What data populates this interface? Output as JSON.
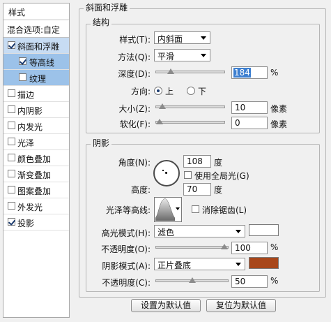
{
  "sidebar": {
    "header": "样式",
    "blend_options": "混合选项:自定",
    "items": [
      {
        "label": "斜面和浮雕",
        "checked": true
      },
      {
        "label": "等高线",
        "checked": true
      },
      {
        "label": "纹理",
        "checked": false
      },
      {
        "label": "描边",
        "checked": false
      },
      {
        "label": "内阴影",
        "checked": false
      },
      {
        "label": "内发光",
        "checked": false
      },
      {
        "label": "光泽",
        "checked": false
      },
      {
        "label": "颜色叠加",
        "checked": false
      },
      {
        "label": "渐变叠加",
        "checked": false
      },
      {
        "label": "图案叠加",
        "checked": false
      },
      {
        "label": "外发光",
        "checked": false
      },
      {
        "label": "投影",
        "checked": true
      }
    ]
  },
  "bevel": {
    "title": "斜面和浮雕",
    "structure": {
      "title": "结构",
      "style_label": "样式(T):",
      "style_value": "内斜面",
      "technique_label": "方法(Q):",
      "technique_value": "平滑",
      "depth_label": "深度(D):",
      "depth_value": "184",
      "depth_unit": "%",
      "depth_level": 0.184,
      "direction_label": "方向:",
      "direction_up": "上",
      "direction_down": "下",
      "size_label": "大小(Z):",
      "size_value": "10",
      "size_unit": "像素",
      "size_level": 0.04,
      "soften_label": "软化(F):",
      "soften_value": "0",
      "soften_unit": "像素",
      "soften_level": 0.0
    },
    "shading": {
      "title": "阴影",
      "angle_label": "角度(N):",
      "angle_value": "108",
      "angle_unit": "度",
      "global_light_label": "使用全局光(G)",
      "altitude_label": "高度:",
      "altitude_value": "70",
      "altitude_unit": "度",
      "gloss_contour_label": "光泽等高线:",
      "anti_aliased_label": "消除锯齿(L)",
      "highlight_mode_label": "高光模式(H):",
      "highlight_mode_value": "滤色",
      "highlight_color": "#ffffff",
      "highlight_opacity_label": "不透明度(O):",
      "highlight_opacity_value": "100",
      "highlight_opacity_unit": "%",
      "highlight_opacity_level": 1.0,
      "shadow_mode_label": "阴影模式(A):",
      "shadow_mode_value": "正片叠底",
      "shadow_color": "#a8471b",
      "shadow_opacity_label": "不透明度(C):",
      "shadow_opacity_value": "50",
      "shadow_opacity_unit": "%",
      "shadow_opacity_level": 0.5
    }
  },
  "buttons": {
    "make_default": "设置为默认值",
    "reset_default": "复位为默认值"
  }
}
